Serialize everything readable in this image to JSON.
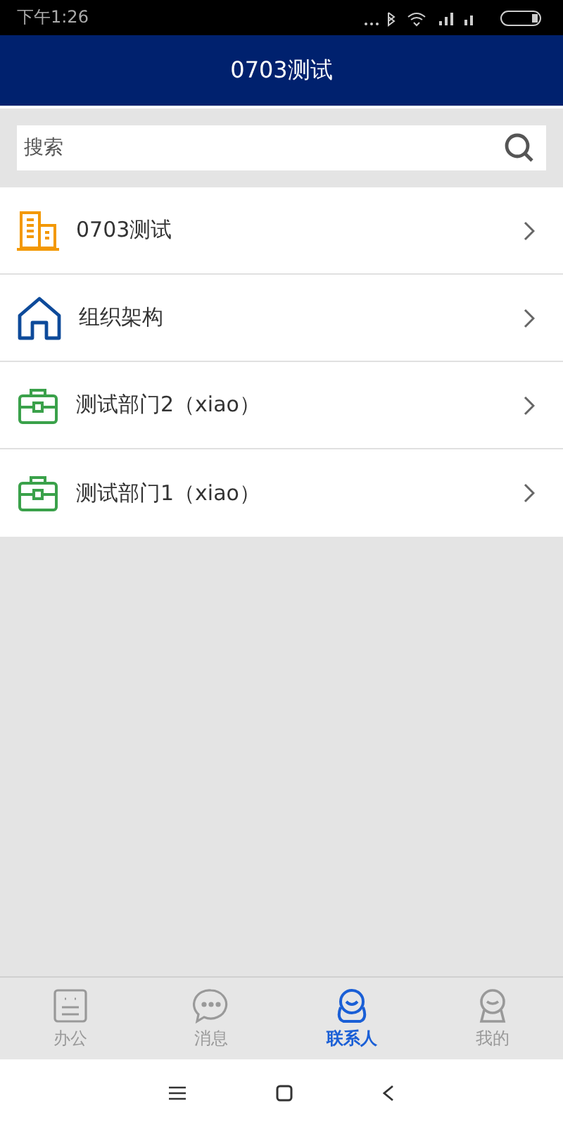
{
  "status_bar": {
    "time": "下午1:26"
  },
  "header": {
    "title": "0703测试"
  },
  "search": {
    "placeholder": "搜索"
  },
  "list": [
    {
      "kind": "building",
      "label": "0703测试"
    },
    {
      "kind": "house",
      "label": "组织架构"
    },
    {
      "kind": "briefcase",
      "label": "测试部门2（xiao）"
    },
    {
      "kind": "briefcase",
      "label": "测试部门1（xiao）"
    }
  ],
  "tabs": [
    {
      "kind": "office",
      "label": "办公",
      "selected": false
    },
    {
      "kind": "messages",
      "label": "消息",
      "selected": false
    },
    {
      "kind": "contacts",
      "label": "联系人",
      "selected": true
    },
    {
      "kind": "me",
      "label": "我的",
      "selected": false
    }
  ]
}
